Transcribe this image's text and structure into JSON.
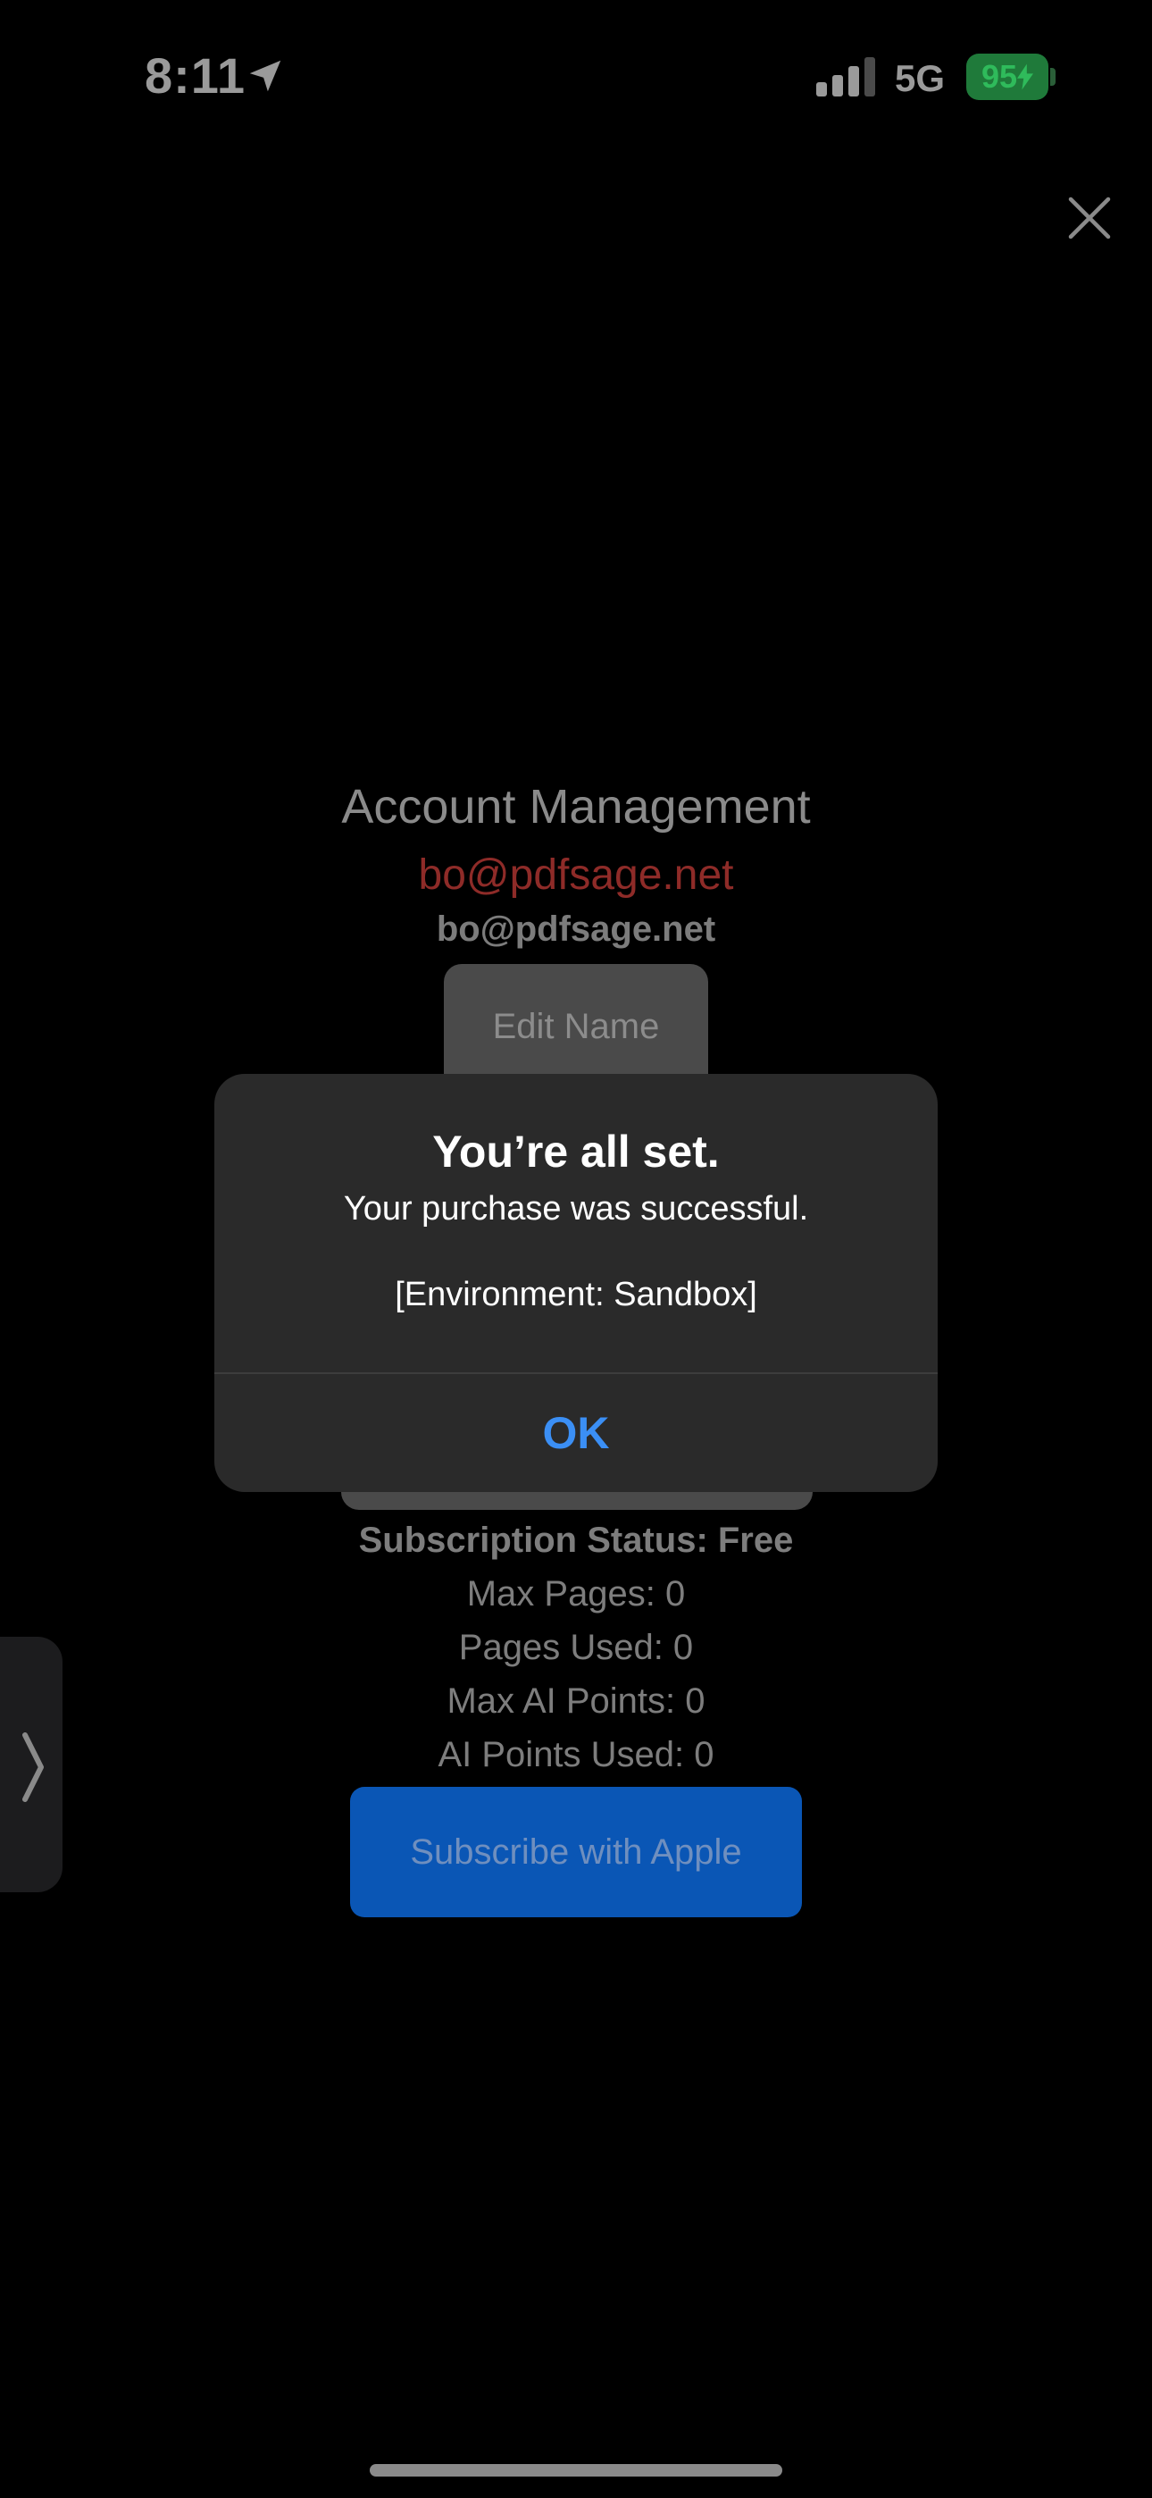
{
  "status_bar": {
    "time": "8:11",
    "network": "5G",
    "battery": "95",
    "icons": [
      "location-arrow-icon",
      "cellular-signal-icon",
      "battery-charging-icon"
    ]
  },
  "close_icon": "close-icon",
  "account": {
    "title": "Account Management",
    "email_highlight": "bo@pdfsage.net",
    "email": "bo@pdfsage.net",
    "edit_name_label": "Edit Name",
    "subscription_status": "Subscription Status: Free",
    "stats": [
      "Max Pages: 0",
      "Pages Used: 0",
      "Max AI Points: 0",
      "AI Points Used: 0"
    ],
    "subscribe_label": "Subscribe with Apple"
  },
  "alert": {
    "title": "You’re all set.",
    "message": "Your purchase was successful.",
    "environment": "[Environment: Sandbox]",
    "ok_label": "OK"
  },
  "colors": {
    "background": "#000000",
    "alert_background": "#2a2a2a",
    "accent_blue": "#3b8ff5",
    "subscribe_button": "#0a56b5",
    "email_red": "#8e2b28",
    "battery_green": "#2fbb5b"
  }
}
